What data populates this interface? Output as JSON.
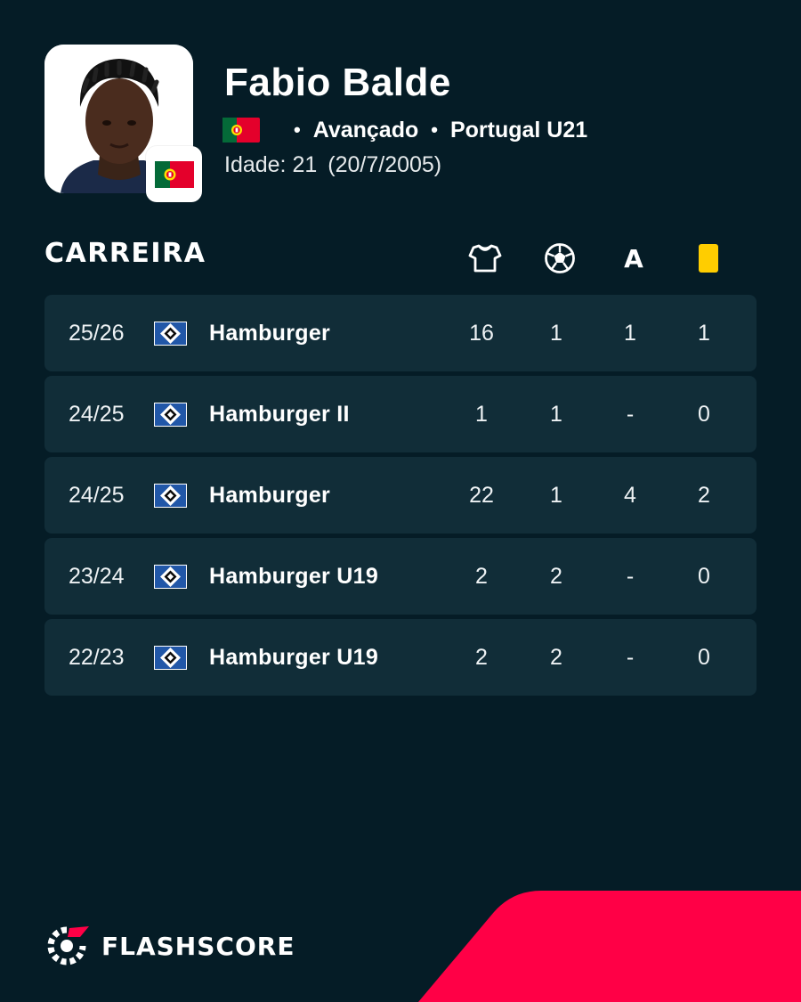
{
  "player": {
    "name": "Fabio Balde",
    "position": "Avançado",
    "team": "Portugal U21",
    "age_label": "Idade: 21",
    "birth_date": "(20/7/2005)",
    "flag_icon": "portugal-flag-icon"
  },
  "career": {
    "title": "CARREIRA",
    "columns": [
      {
        "icon": "jersey-icon"
      },
      {
        "icon": "football-icon"
      },
      {
        "icon": "assists-icon",
        "label": "A"
      },
      {
        "icon": "yellow-card-icon"
      }
    ],
    "rows": [
      {
        "season": "25/26",
        "club": "Hamburger",
        "apps": "16",
        "goals": "1",
        "assists": "1",
        "cards": "1"
      },
      {
        "season": "24/25",
        "club": "Hamburger II",
        "apps": "1",
        "goals": "1",
        "assists": "-",
        "cards": "0"
      },
      {
        "season": "24/25",
        "club": "Hamburger",
        "apps": "22",
        "goals": "1",
        "assists": "4",
        "cards": "2"
      },
      {
        "season": "23/24",
        "club": "Hamburger U19",
        "apps": "2",
        "goals": "2",
        "assists": "-",
        "cards": "0"
      },
      {
        "season": "22/23",
        "club": "Hamburger U19",
        "apps": "2",
        "goals": "2",
        "assists": "-",
        "cards": "0"
      }
    ]
  },
  "brand": {
    "name": "FLASHSCORE"
  },
  "colors": {
    "background": "#051c26",
    "row_background": "#112d38",
    "accent_red": "#ff0046",
    "yellow_card": "#ffcd00"
  }
}
